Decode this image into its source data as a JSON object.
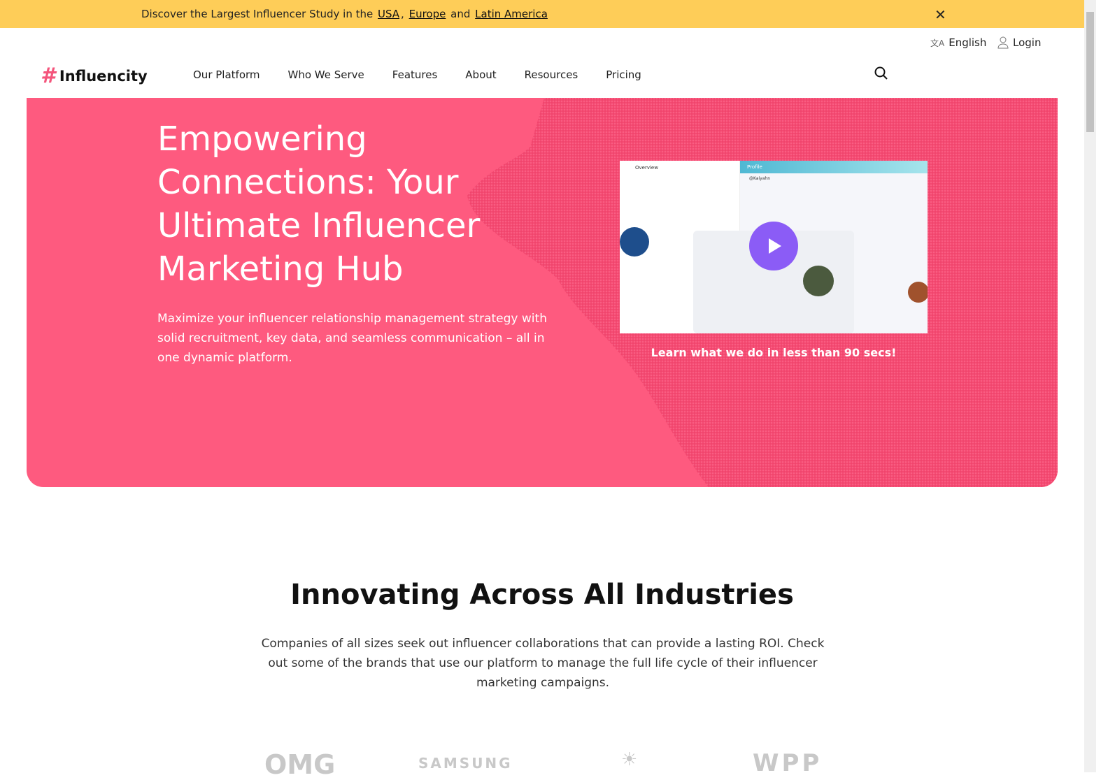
{
  "banner": {
    "prefix": "Discover the Largest Influencer Study in the",
    "link_usa": "USA",
    "comma": ",",
    "link_europe": "Europe",
    "and": "and",
    "link_latam": "Latin America"
  },
  "utility": {
    "language": "English",
    "login": "Login"
  },
  "logo": {
    "name": "Influencity"
  },
  "nav": [
    "Our Platform",
    "Who We Serve",
    "Features",
    "About",
    "Resources",
    "Pricing"
  ],
  "hero": {
    "title": "Empowering Connections: Your Ultimate Influencer Marketing Hub",
    "subtitle": "Maximize your influencer relationship management strategy with solid recruitment, key data, and seamless communication – all in one dynamic platform.",
    "video_caption": "Learn what we do in less than 90 secs!",
    "video": {
      "overview_title": "Overview",
      "profile_title": "Profile",
      "handle": "@Kaiyahn"
    }
  },
  "industries": {
    "title": "Innovating Across All Industries",
    "description": "Companies of all sizes seek out influencer collaborations that can provide a lasting ROI. Check out some of the brands that use our platform to manage the full life cycle of their influencer marketing campaigns."
  },
  "brands": [
    "OMG",
    "SAMSUNG",
    "WPP"
  ],
  "colors": {
    "banner": "#fecd58",
    "hero": "#fe5a7f",
    "accent": "#f4557c",
    "play": "#8b5cf6"
  }
}
